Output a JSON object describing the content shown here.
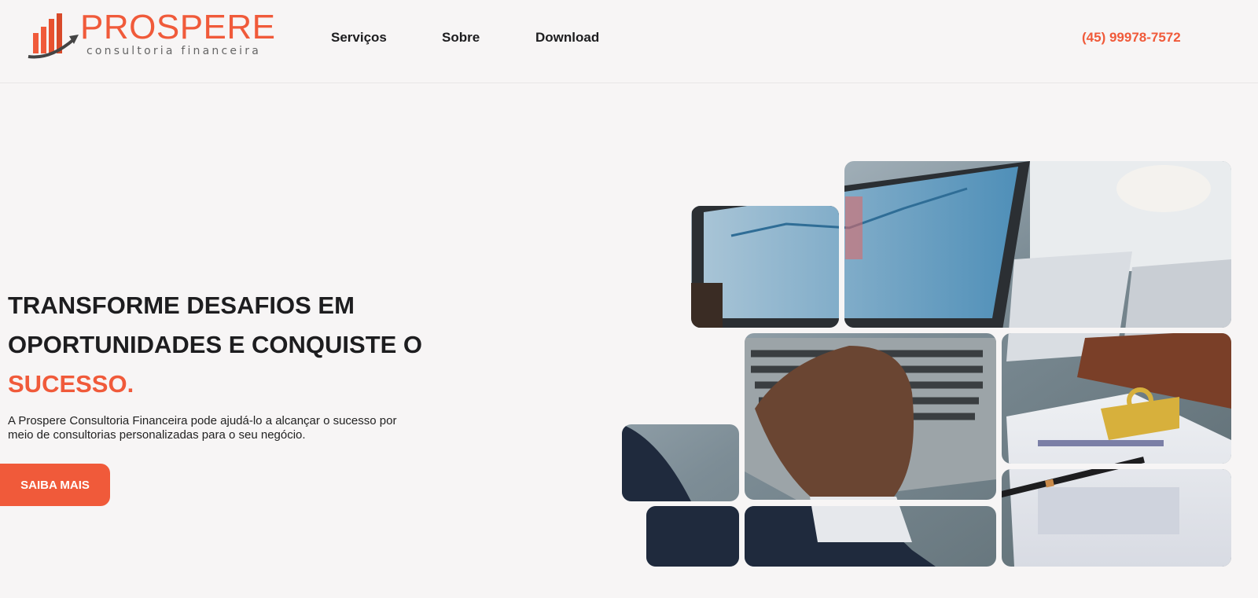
{
  "brand": {
    "name": "PROSPERE",
    "tagline": "consultoria financeira",
    "accent_color": "#f05a3a"
  },
  "nav": {
    "items": [
      {
        "label": "Serviços"
      },
      {
        "label": "Sobre"
      },
      {
        "label": "Download"
      }
    ]
  },
  "contact": {
    "phone": "(45) 99978-7572"
  },
  "hero": {
    "title_line1": "TRANSFORME DESAFIOS EM",
    "title_line2": "OPORTUNIDADES E CONQUISTE O",
    "title_accent": "SUCESSO.",
    "description": "A Prospere Consultoria Financeira pode ajudá-lo a alcançar o sucesso por meio de consultorias personalizadas para o seu negócio.",
    "cta_label": "SAIBA MAIS"
  },
  "hero_image": {
    "icon": "laptop-finance-collage-photo"
  }
}
